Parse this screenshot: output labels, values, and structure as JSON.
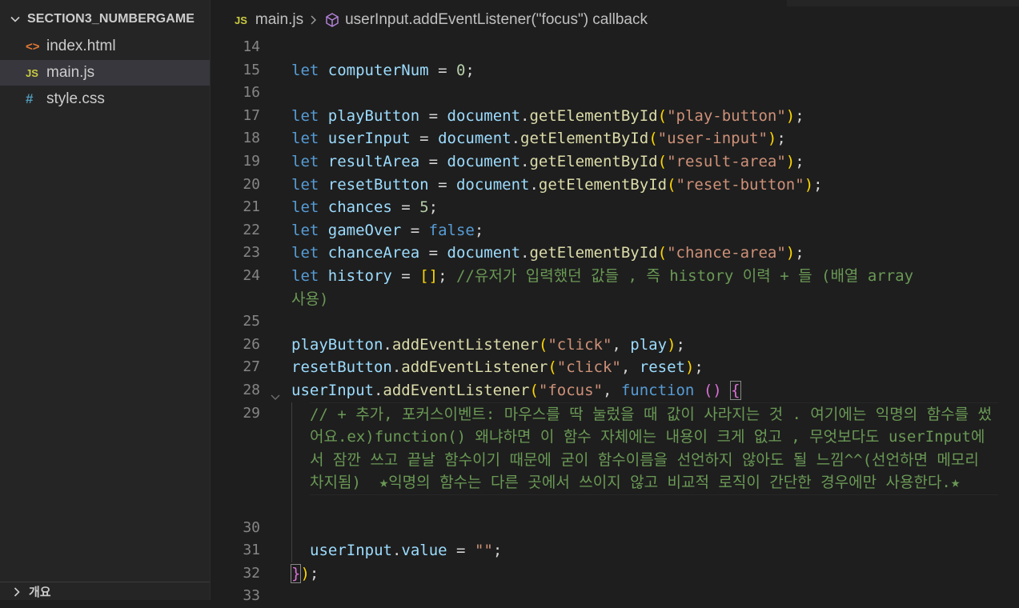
{
  "sidebar": {
    "folder_name": "SECTION3_NUMBERGAME",
    "files": [
      {
        "name": "index.html",
        "icon": "html-file-icon",
        "glyph": "<>",
        "color": "#e37933"
      },
      {
        "name": "main.js",
        "icon": "js-file-icon",
        "glyph": "JS",
        "color": "#cbcb41",
        "active": true
      },
      {
        "name": "style.css",
        "icon": "css-file-icon",
        "glyph": "#",
        "color": "#519aba"
      }
    ],
    "outline_label": "개요"
  },
  "breadcrumb": {
    "file_badge": "JS",
    "file": "main.js",
    "symbol": "userInput.addEventListener(\"focus\") callback"
  },
  "code": {
    "line_numbers": [
      "14",
      "15",
      "16",
      "17",
      "18",
      "19",
      "20",
      "21",
      "22",
      "23",
      "24",
      "25",
      "26",
      "27",
      "28",
      "29",
      "30",
      "31",
      "32",
      "33"
    ],
    "l15": {
      "kw": "let",
      "var": "computerNum",
      "op": " = ",
      "num": "0",
      "end": ";"
    },
    "l17": {
      "kw": "let",
      "var": "playButton",
      "obj": "document",
      "fn": "getElementById",
      "str": "\"play-button\""
    },
    "l18": {
      "kw": "let",
      "var": "userInput",
      "obj": "document",
      "fn": "getElementById",
      "str": "\"user-input\""
    },
    "l19": {
      "kw": "let",
      "var": "resultArea",
      "obj": "document",
      "fn": "getElementById",
      "str": "\"result-area\""
    },
    "l20": {
      "kw": "let",
      "var": "resetButton",
      "obj": "document",
      "fn": "getElementById",
      "str": "\"reset-button\""
    },
    "l21": {
      "kw": "let",
      "var": "chances",
      "num": "5"
    },
    "l22": {
      "kw": "let",
      "var": "gameOver",
      "val": "false"
    },
    "l23": {
      "kw": "let",
      "var": "chanceArea",
      "obj": "document",
      "fn": "getElementById",
      "str": "\"chance-area\""
    },
    "l24": {
      "kw": "let",
      "var": "history",
      "open": "[",
      "close": "]",
      "comment": "//유저가 입력했던 값들 , 즉 history 이력 + 들 (배열 array사용)"
    },
    "l26": {
      "var": "playButton",
      "fn": "addEventListener",
      "str": "\"click\"",
      "arg": "play"
    },
    "l27": {
      "var": "resetButton",
      "fn": "addEventListener",
      "str": "\"click\"",
      "arg": "reset"
    },
    "l28": {
      "var": "userInput",
      "fn": "addEventListener",
      "str": "\"focus\"",
      "kw": "function"
    },
    "l29": {
      "comment": "// + 추가, 포커스이벤트: 마우스를 딱 눌렀을 때 값이 사라지는 것 . 여기에는 익명의 함수를 썼어요.ex)function() 왜냐하면 이 함수 자체에는 내용이 크게 없고 , 무엇보다도 userInput에서 잠깐 쓰고 끝날 함수이기 때문에 굳이 함수이름을 선언하지 않아도 될 느낌^^(선언하면 메모리 차지됨)  ★익명의 함수는 다른 곳에서 쓰이지 않고 비교적 로직이 간단한 경우에만 사용한다.★"
    },
    "l31": {
      "var": "userInput",
      "prop": "value",
      "str": "\"\""
    },
    "l32": {
      "close": "}",
      "paren": ")",
      "end": ";"
    }
  }
}
